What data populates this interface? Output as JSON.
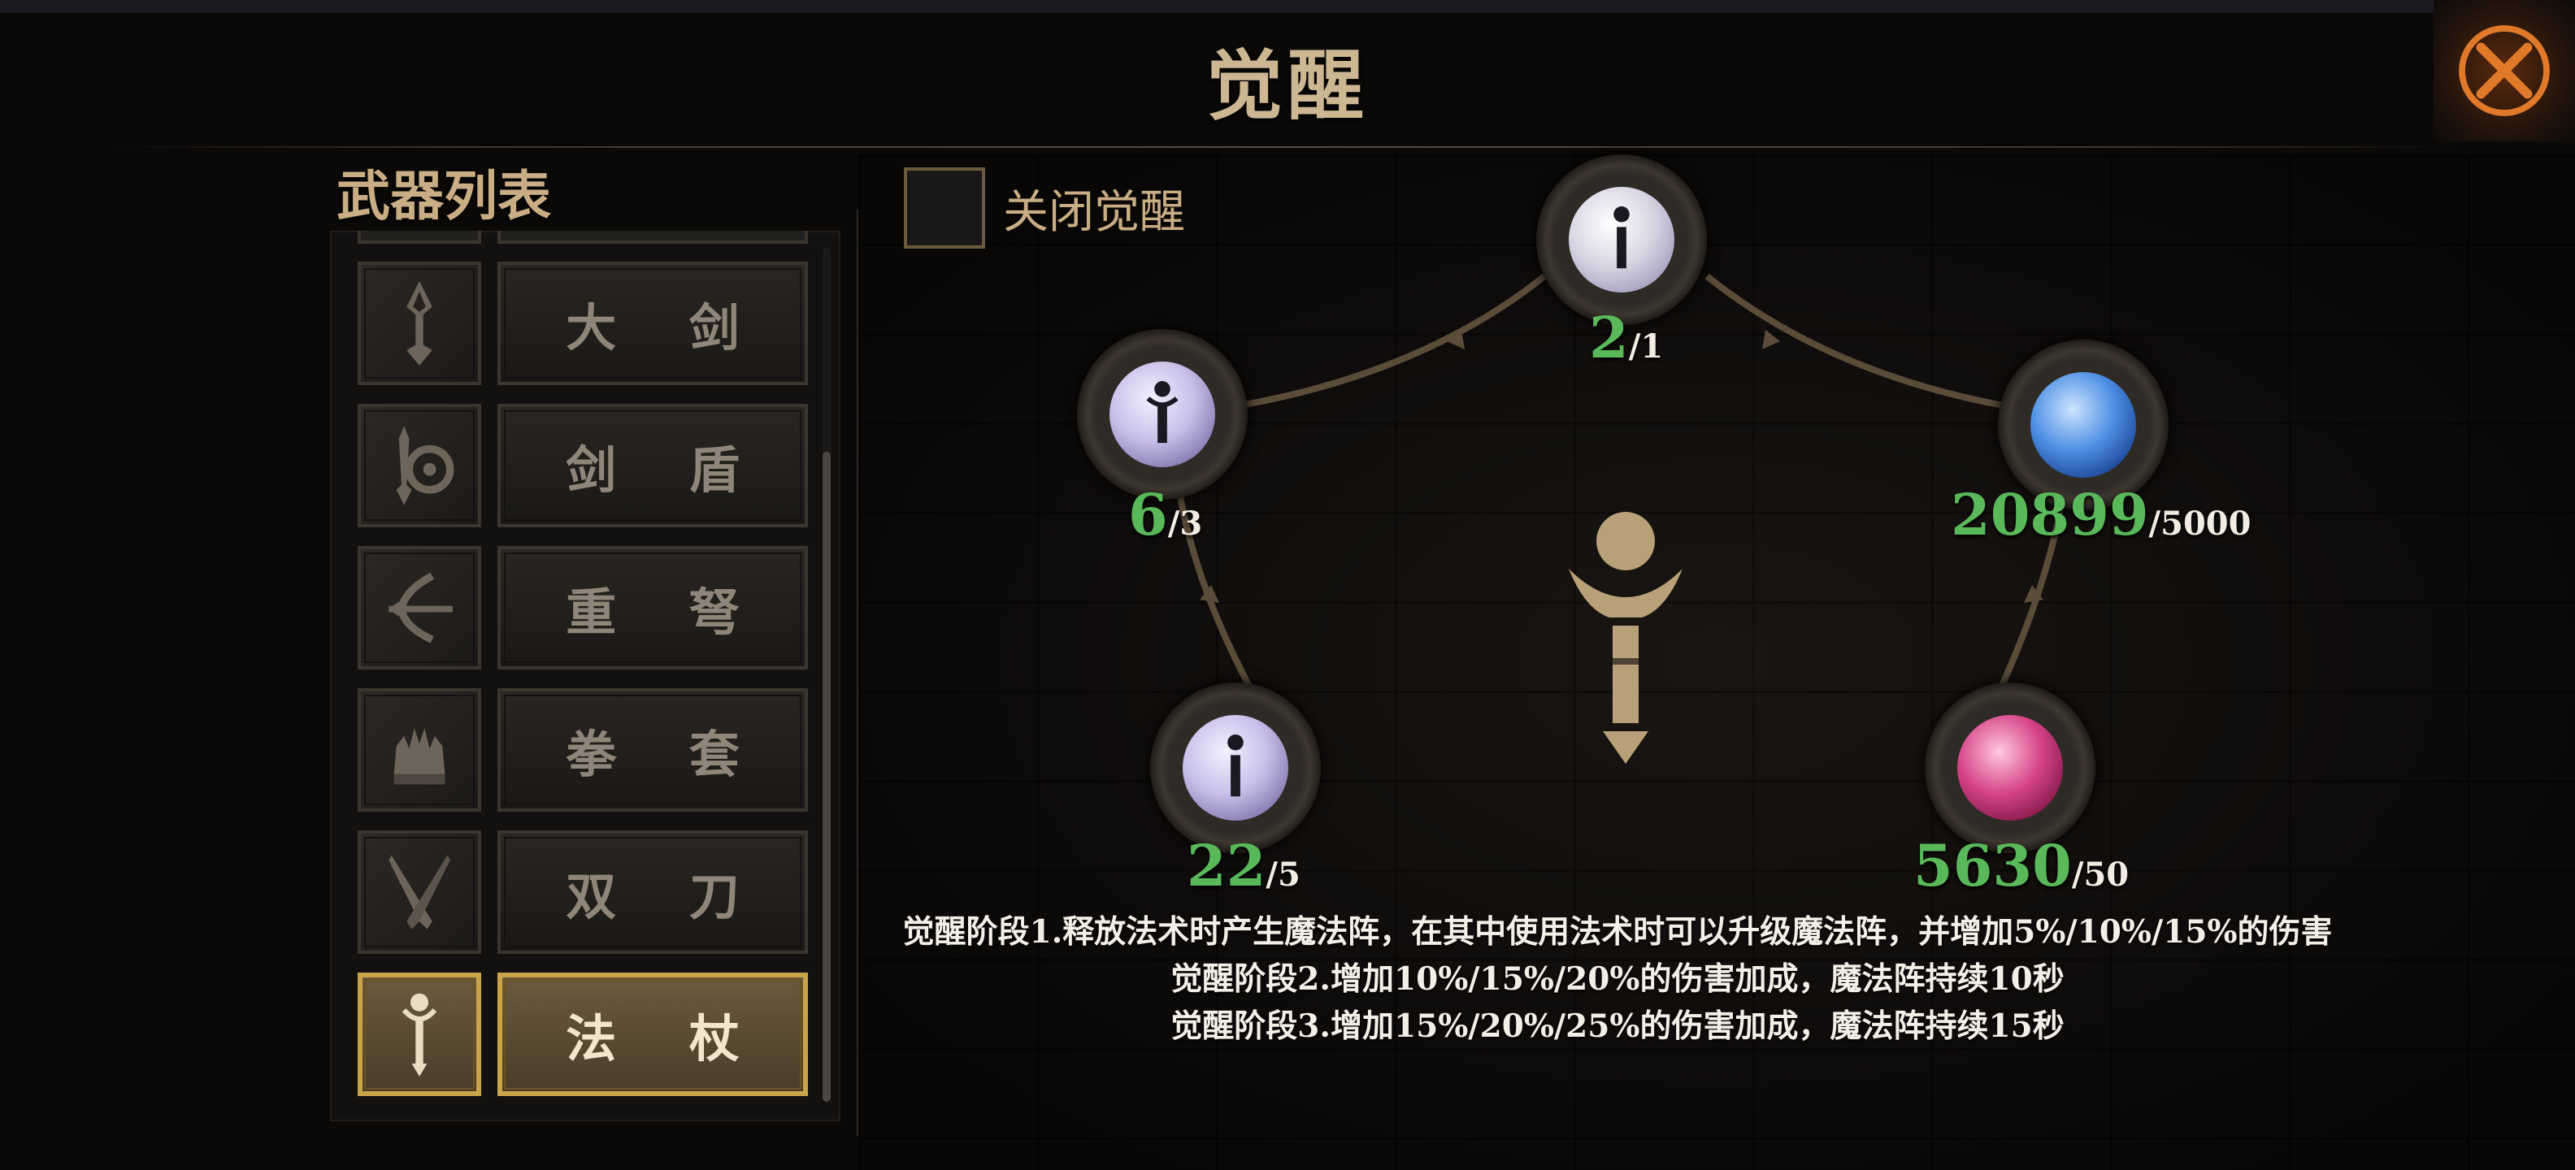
{
  "screen": {
    "title": "觉醒"
  },
  "weapon_list": {
    "heading": "武器列表",
    "items": [
      {
        "label": "大 剑",
        "icon": "greatsword-icon",
        "active": false
      },
      {
        "label": "剑 盾",
        "icon": "sword-shield-icon",
        "active": false
      },
      {
        "label": "重 弩",
        "icon": "heavy-crossbow-icon",
        "active": false
      },
      {
        "label": "拳 套",
        "icon": "gauntlet-icon",
        "active": false
      },
      {
        "label": "双 刀",
        "icon": "dual-blades-icon",
        "active": false
      },
      {
        "label": "法 杖",
        "icon": "staff-icon",
        "active": true
      }
    ]
  },
  "awaken_panel": {
    "toggle_label": "关闭觉醒",
    "toggle_checked": false,
    "nodes": [
      {
        "id": "top",
        "current": "2",
        "required": "/1",
        "orb": "white-staff-orb"
      },
      {
        "id": "left",
        "current": "6",
        "required": "/3",
        "orb": "lavender-staff-orb"
      },
      {
        "id": "right",
        "current": "20899",
        "required": "/5000",
        "orb": "blue-orb"
      },
      {
        "id": "bottom-left",
        "current": "22",
        "required": "/5",
        "orb": "lavender-staff-orb"
      },
      {
        "id": "bottom-right",
        "current": "5630",
        "required": "/50",
        "orb": "pink-orb"
      }
    ],
    "center_icon": "staff-emblem-icon",
    "description": [
      "觉醒阶段1.释放法术时产生魔法阵，在其中使用法术时可以升级魔法阵，并增加5%/10%/15%的伤害",
      "觉醒阶段2.增加10%/15%/20%的伤害加成，魔法阵持续10秒",
      "觉醒阶段3.增加15%/20%/25%的伤害加成，魔法阵持续15秒"
    ]
  },
  "colors": {
    "gold": "#c9a449",
    "count_green": "#59b85a",
    "title_tan": "#cdb692"
  }
}
